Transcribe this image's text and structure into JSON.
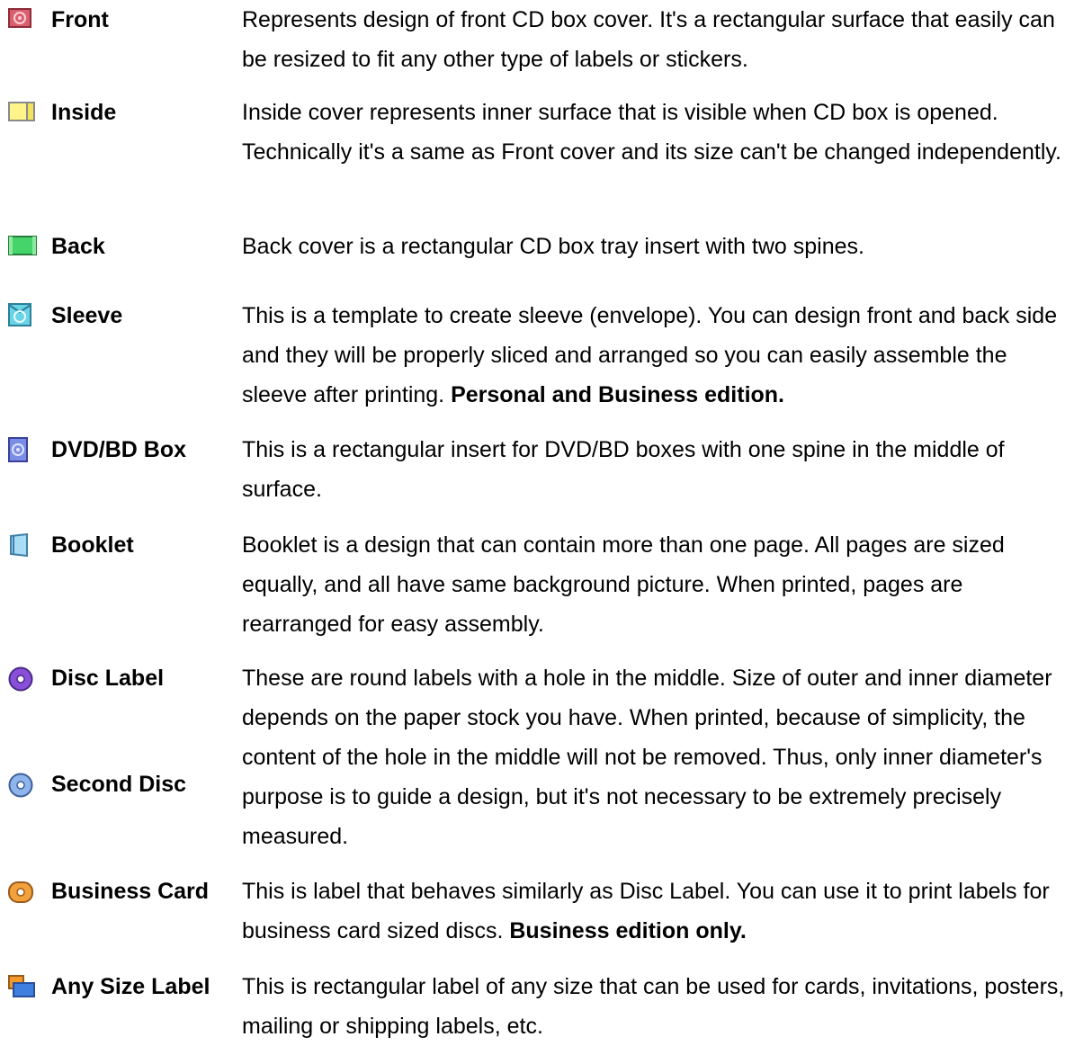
{
  "items": [
    {
      "icon": "front-cover-icon",
      "term": "Front",
      "desc": "Represents design of front CD box cover. It's a rectangular surface that easily can be resized to fit any other type of labels or stickers.",
      "note": ""
    },
    {
      "icon": "inside-cover-icon",
      "term": "Inside",
      "desc": "Inside cover represents inner surface that is visible when CD box is opened. Technically it's a same as Front cover and its size can't be changed independently.",
      "note": ""
    },
    {
      "icon": "back-cover-icon",
      "term": "Back",
      "desc": "Back cover is a rectangular CD box tray insert with two spines.",
      "note": ""
    },
    {
      "icon": "sleeve-icon",
      "term": "Sleeve",
      "desc": "This is a template to create sleeve (envelope). You can design front and back side and they will be properly sliced and arranged so you can easily assemble the sleeve after printing. ",
      "note": "Personal and Business edition."
    },
    {
      "icon": "dvd-bd-box-icon",
      "term": "DVD/BD Box",
      "desc": "This is a rectangular insert for DVD/BD boxes with one spine in the middle of surface.",
      "note": ""
    },
    {
      "icon": "booklet-icon",
      "term": "Booklet",
      "desc": "Booklet is a design that can contain more than one page. All pages are sized equally, and all have same background picture. When printed, pages are rearranged for easy assembly.",
      "note": ""
    },
    {
      "icon": "disc-label-icon",
      "term": "Disc Label",
      "term2_icon": "second-disc-icon",
      "term2": "Second Disc",
      "desc": "These are round labels with a hole in the middle. Size of outer and inner diameter depends on the paper stock you have. When printed, because of simplicity, the content of the hole in the middle will not be removed. Thus, only inner diameter's purpose is to guide a design, but it's not necessary to be extremely precisely measured.",
      "note": ""
    },
    {
      "icon": "business-card-icon",
      "term": "Business Card",
      "desc": "This is label that behaves similarly as Disc Label. You can use it to print labels for business card sized discs. ",
      "note": "Business edition only."
    },
    {
      "icon": "any-size-label-icon",
      "term": "Any Size Label",
      "desc": "This is rectangular label of any size that can be used for cards, invitations, posters, mailing or shipping labels, etc.",
      "note": ""
    }
  ]
}
